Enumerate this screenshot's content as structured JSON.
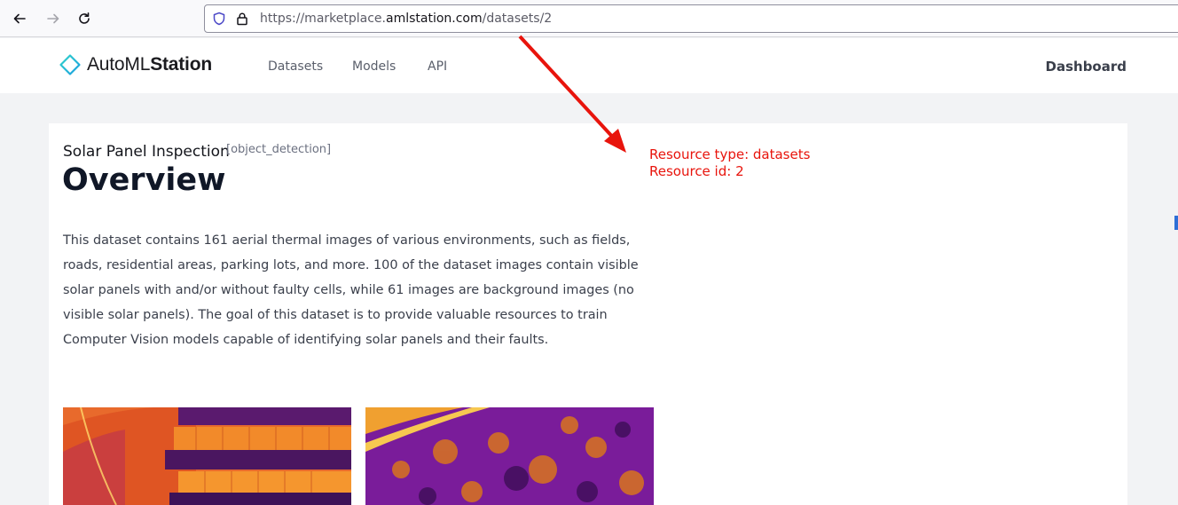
{
  "browser": {
    "url_prefix": "https://marketplace.",
    "url_host": "amlstation.com",
    "url_path": "/datasets/2"
  },
  "header": {
    "logo_light": "AutoML",
    "logo_bold": "Station",
    "nav": [
      "Datasets",
      "Models",
      "API"
    ],
    "dashboard_label": "Dashboard"
  },
  "dataset": {
    "title": "Solar Panel Inspection",
    "tag": "[object_detection]",
    "heading": "Overview",
    "description": "This dataset contains 161 aerial thermal images of various environments, such as fields, roads, residential areas, parking lots, and more. 100 of the dataset images contain visible solar panels with and/or without faulty cells, while 61 images are background images (no visible solar panels). The goal of this dataset is to provide valuable resources to train Computer Vision models capable of identifying solar panels and their faults."
  },
  "annotation": {
    "line1": "Resource type: datasets",
    "line2": "Resource id: 2",
    "color": "#e8140c"
  },
  "colors": {
    "accent": "#1ab8d6",
    "page_bg": "#f2f3f5"
  }
}
